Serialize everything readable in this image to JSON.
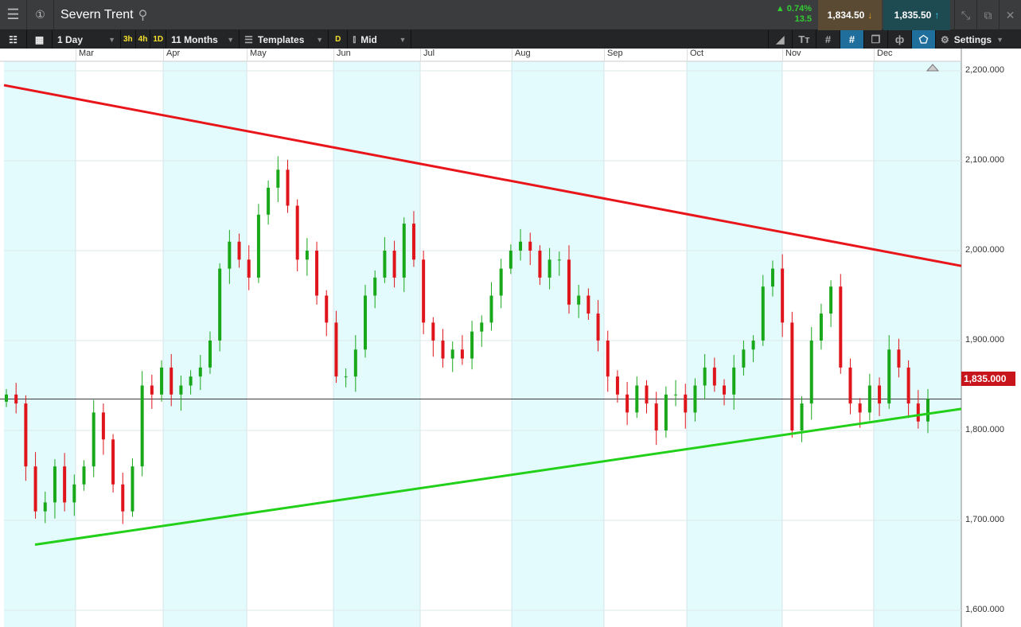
{
  "header": {
    "title": "Severn Trent",
    "change_pct": "▲ 0.74%",
    "change_abs": "13.5",
    "bid": "1,834.50",
    "ask": "1,835.50"
  },
  "toolbar": {
    "interval": "1 Day",
    "q3h": "3h",
    "q4h": "4h",
    "q1d": "1D",
    "range": "11 Months",
    "templates": "Templates",
    "d": "D",
    "price_type": "Mid",
    "settings": "Settings"
  },
  "chart_data": {
    "type": "candlestick",
    "title": "Severn Trent",
    "x_tick_labels": [
      "Mar",
      "Apr",
      "May",
      "Jun",
      "Jul",
      "Aug",
      "Sep",
      "Oct",
      "Nov",
      "Dec"
    ],
    "y_tick_labels": [
      "2,200.000",
      "2,100.000",
      "2,000.000",
      "1,900.000",
      "1,800.000",
      "1,700.000",
      "1,600.000"
    ],
    "y_ticks": [
      2200,
      2100,
      2000,
      1900,
      1800,
      1700,
      1600
    ],
    "ylim": [
      1600,
      2200
    ],
    "current_price": 1835,
    "current_price_label": "1,835.000",
    "closes": [
      1840,
      1830,
      1760,
      1710,
      1720,
      1760,
      1720,
      1740,
      1760,
      1820,
      1790,
      1740,
      1710,
      1760,
      1850,
      1840,
      1870,
      1840,
      1850,
      1860,
      1870,
      1900,
      1980,
      2010,
      1990,
      1970,
      2040,
      2070,
      2090,
      2050,
      1990,
      2000,
      1950,
      1920,
      1860,
      1860,
      1890,
      1950,
      1970,
      2000,
      1970,
      2030,
      1990,
      1920,
      1900,
      1880,
      1890,
      1880,
      1910,
      1920,
      1950,
      1980,
      2000,
      2010,
      2000,
      1970,
      1990,
      1990,
      1940,
      1950,
      1930,
      1900,
      1860,
      1840,
      1820,
      1850,
      1830,
      1800,
      1840,
      1840,
      1820,
      1850,
      1870,
      1850,
      1840,
      1870,
      1890,
      1900,
      1960,
      1980,
      1920,
      1800,
      1830,
      1900,
      1930,
      1960,
      1870,
      1830,
      1820,
      1850,
      1830,
      1890,
      1870,
      1830,
      1810,
      1835
    ],
    "trendlines": [
      {
        "name": "resistance",
        "color": "#e8151b",
        "from": 2184,
        "to": 1983
      },
      {
        "name": "support",
        "color": "#22d01a",
        "from": 1673,
        "to": 1824
      }
    ],
    "colors": {
      "up": "#18a81a",
      "down": "#e0141b"
    }
  }
}
